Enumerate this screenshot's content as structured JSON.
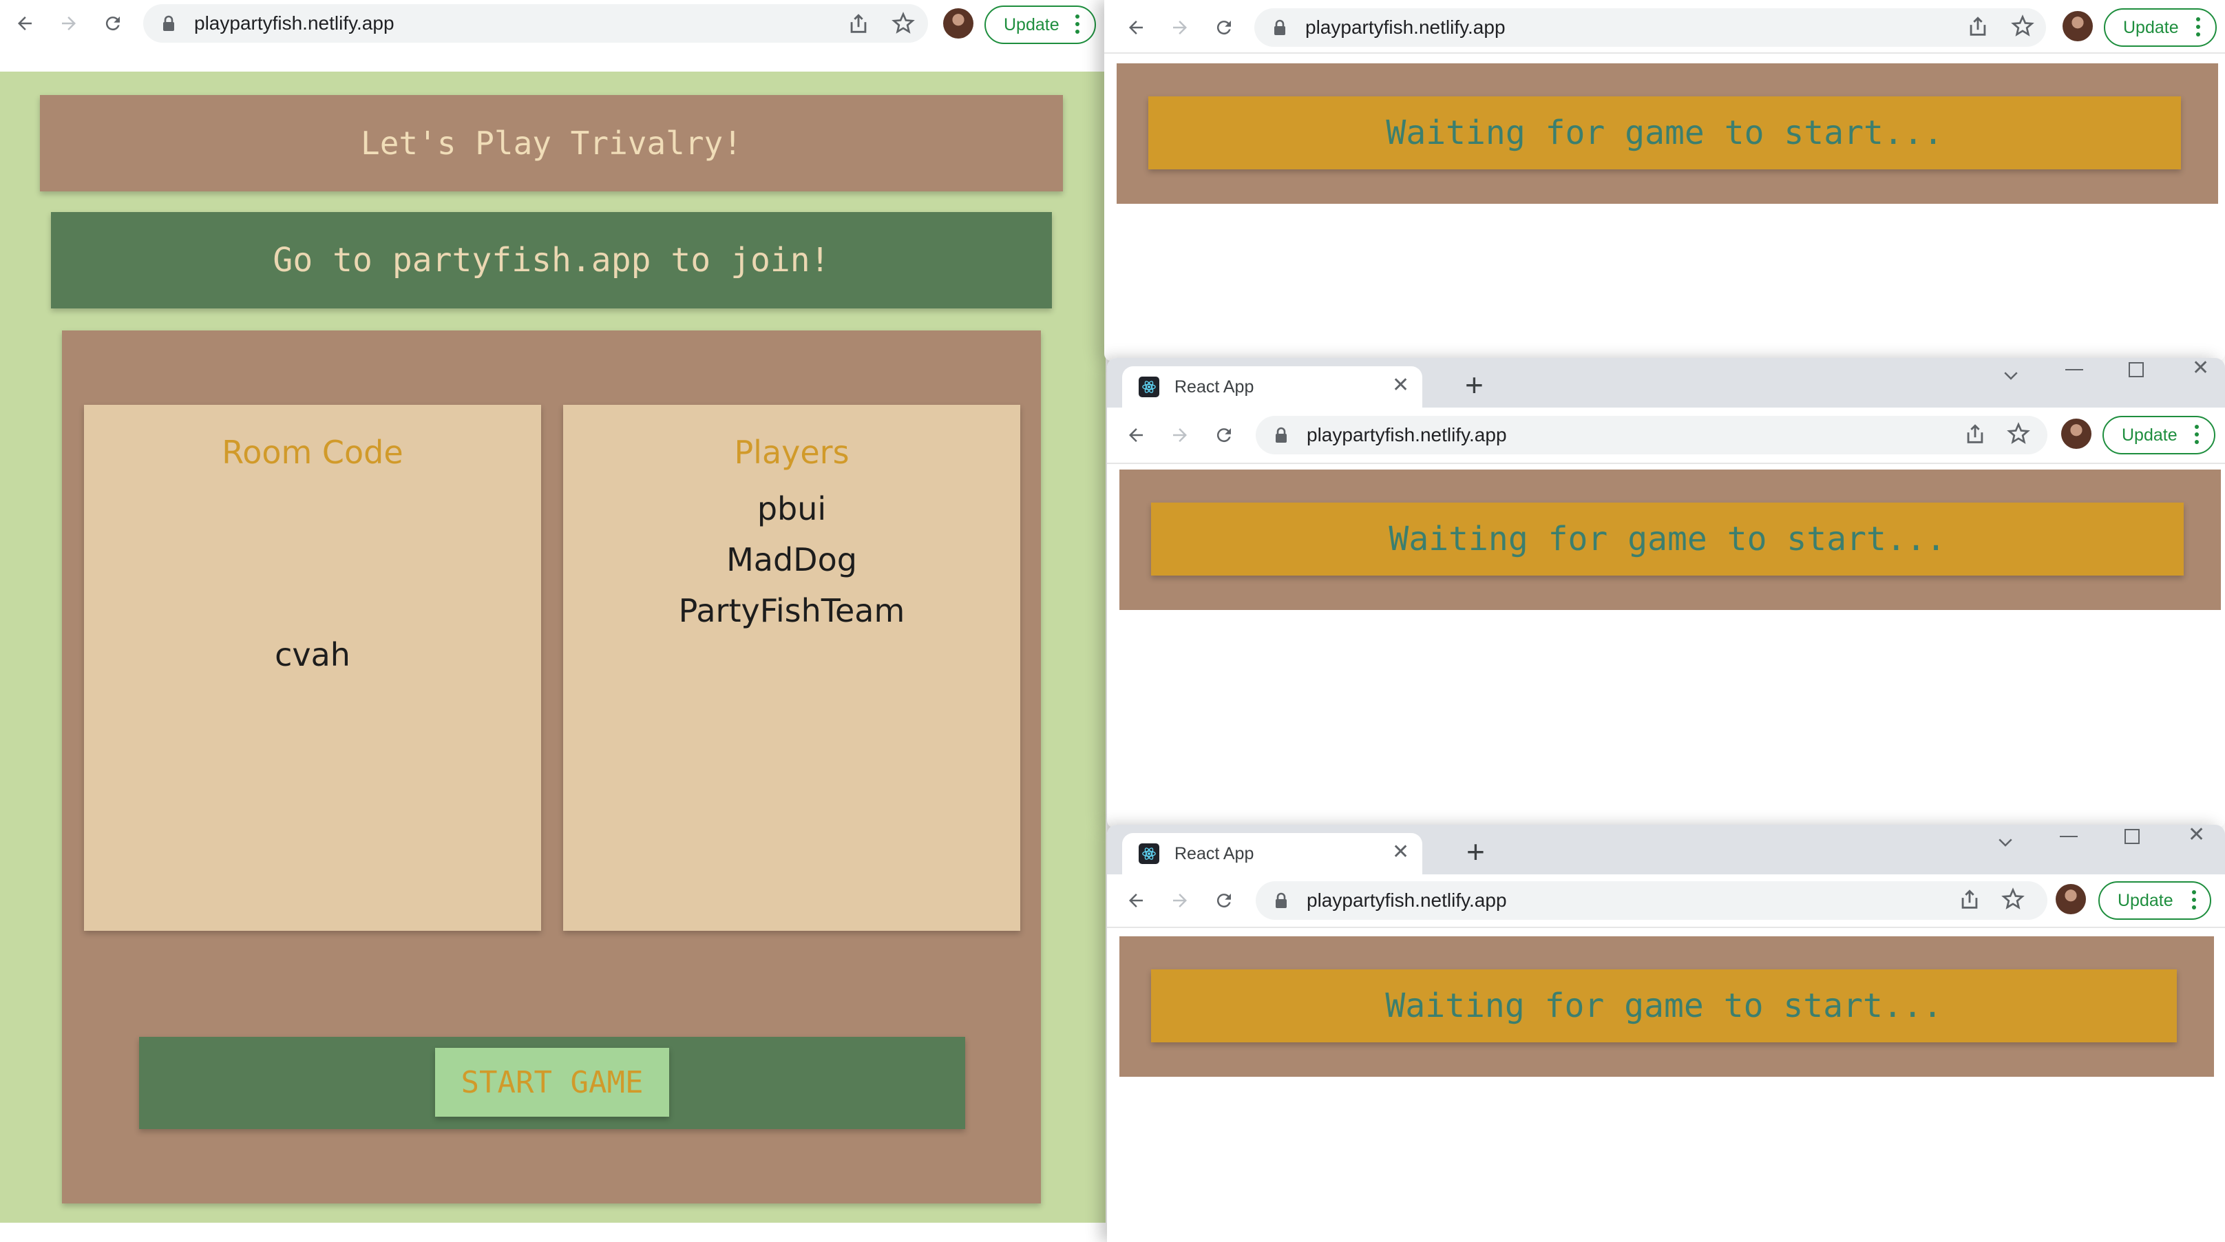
{
  "host": {
    "url": "playpartyfish.netlify.app",
    "update_label": "Update",
    "game": {
      "title": "Let's Play Trivalry!",
      "join_banner": "Go to partyfish.app to join!",
      "room_code_heading": "Room Code",
      "room_code": "cvah",
      "players_heading": "Players",
      "players": [
        "pbui",
        "MadDog",
        "PartyFishTeam"
      ],
      "start_label": "START GAME"
    }
  },
  "player_windows": [
    {
      "tab_title": "",
      "url": "playpartyfish.netlify.app",
      "update_label": "Update",
      "status": "Waiting for game to start..."
    },
    {
      "tab_title": "React App",
      "url": "playpartyfish.netlify.app",
      "update_label": "Update",
      "status": "Waiting for game to start..."
    },
    {
      "tab_title": "React App",
      "url": "playpartyfish.netlify.app",
      "update_label": "Update",
      "status": "Waiting for game to start..."
    }
  ],
  "colors": {
    "page_green": "#c5daa1",
    "card_brown": "#ab8870",
    "dark_green": "#577c56",
    "panel_beige": "#e2c9a5",
    "mustard": "#d19a2a",
    "button_green": "#a5d598",
    "teal_text": "#3b7f6f",
    "update_green": "#1e8e3e"
  },
  "icons": [
    "back-arrow-icon",
    "forward-arrow-icon",
    "reload-icon",
    "lock-icon",
    "share-icon",
    "star-icon",
    "react-favicon-icon",
    "close-icon",
    "plus-icon",
    "chevron-down-icon",
    "minimize-icon",
    "maximize-icon"
  ]
}
